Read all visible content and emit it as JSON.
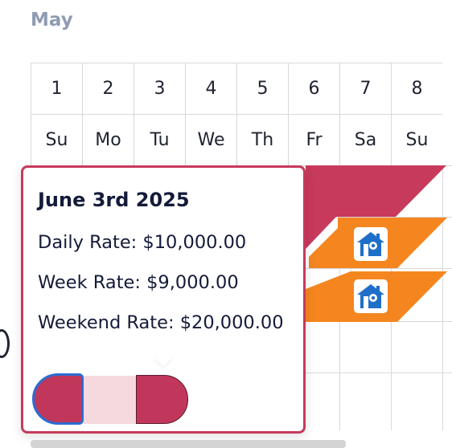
{
  "month": "May",
  "days": [
    {
      "num": "1",
      "dow": "Su"
    },
    {
      "num": "2",
      "dow": "Mo"
    },
    {
      "num": "3",
      "dow": "Tu"
    },
    {
      "num": "4",
      "dow": "We"
    },
    {
      "num": "5",
      "dow": "Th"
    },
    {
      "num": "6",
      "dow": "Fr"
    },
    {
      "num": "7",
      "dow": "Sa"
    },
    {
      "num": "8",
      "dow": "Su"
    }
  ],
  "colors": {
    "booked": "#c73a5c",
    "pending": "#f5861f",
    "selected": "#c0375b",
    "selected_light": "#f5d9df",
    "selected_border": "#2d6cd2"
  },
  "icons": [
    "house-icon",
    "house-icon"
  ],
  "tooltip": {
    "title": "June 3rd 2025",
    "daily": "Daily Rate: $10,000.00",
    "week": "Week Rate: $9,000.00",
    "weekend": "Weekend Rate: $20,000.00"
  }
}
